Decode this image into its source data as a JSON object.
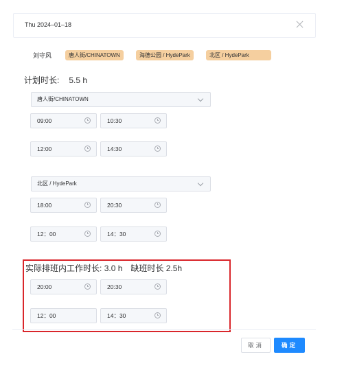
{
  "header": {
    "date": "Thu 2024–01–18"
  },
  "person": {
    "name": "刘守风",
    "tags": [
      "唐人街/CHINATOWN",
      "海德公园 / HydePark",
      "北区 / HydePark"
    ]
  },
  "plan": {
    "label": "计划时长:",
    "value": "5.5 h",
    "groups": [
      {
        "location": "唐人街/CHINATOWN",
        "shifts": [
          {
            "start": "09:00",
            "end": "10:30"
          },
          {
            "start": "12:00",
            "end": "14:30"
          }
        ]
      },
      {
        "location": "北区 / HydePark",
        "shifts": [
          {
            "start": "18:00",
            "end": "20:30"
          },
          {
            "start": "12：00",
            "end": "14：30"
          }
        ]
      }
    ]
  },
  "actual": {
    "label": "实际排班内工作时长:",
    "value": "3.0 h",
    "missing": "缺班时长 2.5h",
    "shifts": [
      {
        "start": "20:00",
        "end": "20:30"
      },
      {
        "start": "12：00",
        "end": "14：30"
      }
    ]
  },
  "footer": {
    "cancel": "取消",
    "confirm": "确定"
  },
  "colors": {
    "primary": "#1e8aff",
    "tag": "#f5cf9f",
    "highlight": "#d9262b"
  }
}
